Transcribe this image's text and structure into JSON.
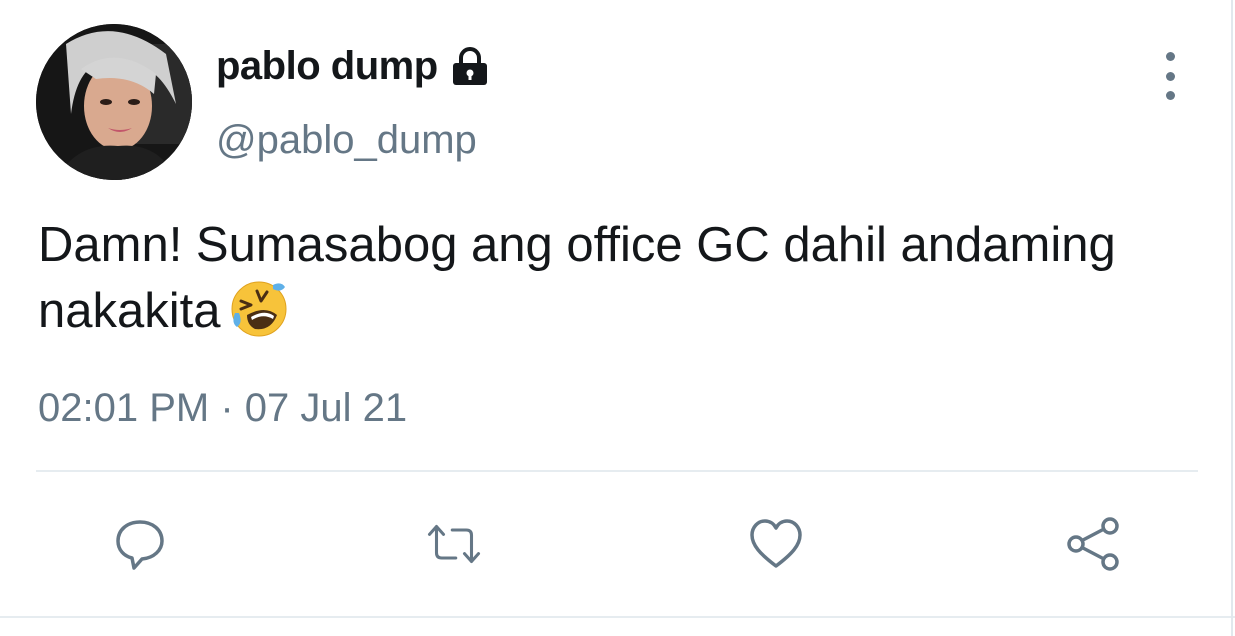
{
  "user": {
    "display_name": "pablo dump",
    "handle": "@pablo_dump",
    "protected_icon": "lock-icon",
    "avatar_icon": "avatar"
  },
  "tweet": {
    "text": "Damn! Sumasabog ang office GC dahil andaming nakakita",
    "emoji": "rolling-on-the-floor-laughing-emoji",
    "time": "02:01 PM",
    "separator": "·",
    "date": "07 Jul 21"
  },
  "actions": [
    {
      "name": "reply",
      "icon": "reply-icon"
    },
    {
      "name": "retweet",
      "icon": "retweet-icon"
    },
    {
      "name": "like",
      "icon": "heart-icon"
    },
    {
      "name": "share",
      "icon": "share-icon"
    }
  ],
  "colors": {
    "text": "#14171a",
    "secondary": "#657786",
    "divider": "#e6ecf0"
  }
}
